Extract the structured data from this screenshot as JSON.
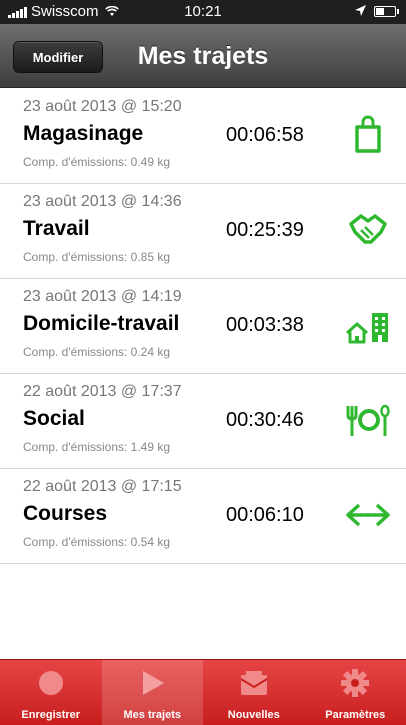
{
  "status_bar": {
    "carrier": "Swisscom",
    "time": "10:21"
  },
  "nav": {
    "title": "Mes trajets",
    "edit_label": "Modifier"
  },
  "trips": [
    {
      "date": "23 août 2013 @ 15:20",
      "name": "Magasinage",
      "duration": "00:06:58",
      "emissions": "Comp. d'émissions: 0.49 kg",
      "icon": "shopping-bag-icon"
    },
    {
      "date": "23 août 2013 @ 14:36",
      "name": "Travail",
      "duration": "00:25:39",
      "emissions": "Comp. d'émissions: 0.85 kg",
      "icon": "handshake-icon"
    },
    {
      "date": "23 août 2013 @ 14:19",
      "name": "Domicile-travail",
      "duration": "00:03:38",
      "emissions": "Comp. d'émissions: 0.24 kg",
      "icon": "home-office-icon"
    },
    {
      "date": "22 août 2013 @ 17:37",
      "name": "Social",
      "duration": "00:30:46",
      "emissions": "Comp. d'émissions: 1.49 kg",
      "icon": "fork-plate-spoon-icon"
    },
    {
      "date": "22 août 2013 @ 17:15",
      "name": "Courses",
      "duration": "00:06:10",
      "emissions": "Comp. d'émissions: 0.54 kg",
      "icon": "two-way-arrows-icon"
    }
  ],
  "tabs": [
    {
      "label": "Enregistrer",
      "icon": "record-icon",
      "active": false
    },
    {
      "label": "Mes trajets",
      "icon": "play-icon",
      "active": true
    },
    {
      "label": "Nouvelles",
      "icon": "news-icon",
      "active": false
    },
    {
      "label": "Paramètres",
      "icon": "gear-icon",
      "active": false
    }
  ],
  "colors": {
    "accent_green": "#2fb82f",
    "tab_red": "#d42a2a",
    "nav_dark": "#4a4a4a"
  }
}
